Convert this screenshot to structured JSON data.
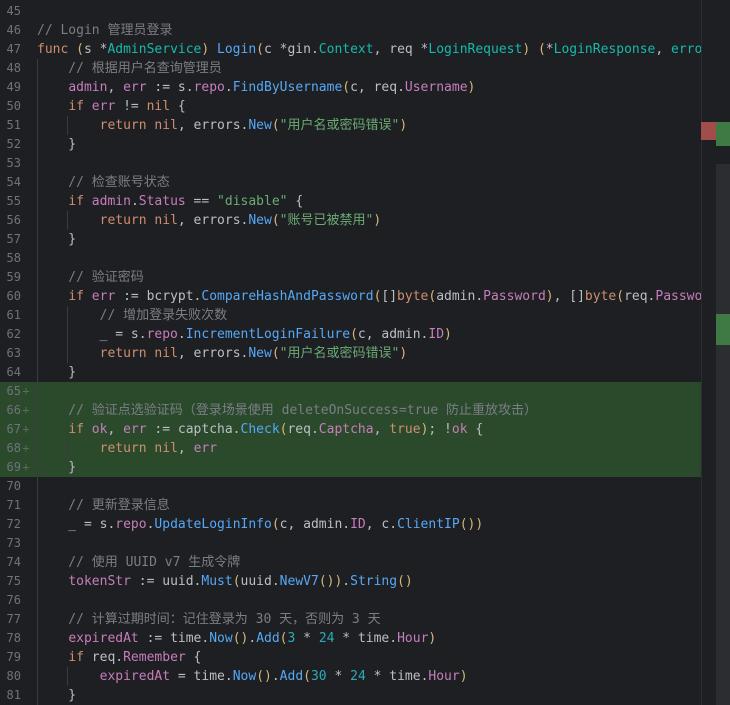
{
  "editor": {
    "lines": [
      {
        "n": "45",
        "added": false,
        "tokens": []
      },
      {
        "n": "46",
        "added": false,
        "tokens": [
          {
            "c": "c",
            "t": "// Login 管理员登录"
          }
        ]
      },
      {
        "n": "47",
        "added": false,
        "tokens": [
          {
            "c": "kw",
            "t": "func "
          },
          {
            "c": "bra",
            "t": "("
          },
          {
            "c": "plain",
            "t": "s "
          },
          {
            "c": "plain",
            "t": "*"
          },
          {
            "c": "ftype",
            "t": "AdminService"
          },
          {
            "c": "bra",
            "t": ")"
          },
          {
            "c": "plain",
            "t": " "
          },
          {
            "c": "fn",
            "t": "Login"
          },
          {
            "c": "bra",
            "t": "("
          },
          {
            "c": "plain",
            "t": "c *"
          },
          {
            "c": "plain",
            "t": "gin"
          },
          {
            "c": "plain",
            "t": "."
          },
          {
            "c": "ftype",
            "t": "Context"
          },
          {
            "c": "plain",
            "t": ", req *"
          },
          {
            "c": "ftype",
            "t": "LoginRequest"
          },
          {
            "c": "bra",
            "t": ")"
          },
          {
            "c": "plain",
            "t": " "
          },
          {
            "c": "bra",
            "t": "("
          },
          {
            "c": "plain",
            "t": "*"
          },
          {
            "c": "ftype",
            "t": "LoginResponse"
          },
          {
            "c": "plain",
            "t": ", "
          },
          {
            "c": "ftype",
            "t": "error"
          },
          {
            "c": "bra",
            "t": ")"
          }
        ]
      },
      {
        "n": "48",
        "added": false,
        "tokens": [
          {
            "c": "c",
            "t": "    // 根据用户名查询管理员"
          }
        ]
      },
      {
        "n": "49",
        "added": false,
        "tokens": [
          {
            "c": "plain",
            "t": "    "
          },
          {
            "c": "fld",
            "t": "admin"
          },
          {
            "c": "plain",
            "t": ", "
          },
          {
            "c": "fld",
            "t": "err"
          },
          {
            "c": "plain",
            "t": " := s."
          },
          {
            "c": "fld",
            "t": "repo"
          },
          {
            "c": "plain",
            "t": "."
          },
          {
            "c": "fn",
            "t": "FindByUsername"
          },
          {
            "c": "bra",
            "t": "("
          },
          {
            "c": "plain",
            "t": "c, req."
          },
          {
            "c": "fld",
            "t": "Username"
          },
          {
            "c": "bra",
            "t": ")"
          }
        ]
      },
      {
        "n": "50",
        "added": false,
        "tokens": [
          {
            "c": "plain",
            "t": "    "
          },
          {
            "c": "kw",
            "t": "if "
          },
          {
            "c": "fld",
            "t": "err"
          },
          {
            "c": "plain",
            "t": " != "
          },
          {
            "c": "kw",
            "t": "nil"
          },
          {
            "c": "plain",
            "t": " {"
          }
        ]
      },
      {
        "n": "51",
        "added": false,
        "tokens": [
          {
            "c": "plain",
            "t": "        "
          },
          {
            "c": "kw",
            "t": "return "
          },
          {
            "c": "kw",
            "t": "nil"
          },
          {
            "c": "plain",
            "t": ", errors."
          },
          {
            "c": "fn",
            "t": "New"
          },
          {
            "c": "bra",
            "t": "("
          },
          {
            "c": "str",
            "t": "\"用户名或密码错误\""
          },
          {
            "c": "bra",
            "t": ")"
          }
        ]
      },
      {
        "n": "52",
        "added": false,
        "tokens": [
          {
            "c": "plain",
            "t": "    }"
          }
        ]
      },
      {
        "n": "53",
        "added": false,
        "tokens": []
      },
      {
        "n": "54",
        "added": false,
        "tokens": [
          {
            "c": "c",
            "t": "    // 检查账号状态"
          }
        ]
      },
      {
        "n": "55",
        "added": false,
        "tokens": [
          {
            "c": "plain",
            "t": "    "
          },
          {
            "c": "kw",
            "t": "if "
          },
          {
            "c": "fld",
            "t": "admin"
          },
          {
            "c": "plain",
            "t": "."
          },
          {
            "c": "fld",
            "t": "Status"
          },
          {
            "c": "plain",
            "t": " == "
          },
          {
            "c": "str",
            "t": "\"disable\""
          },
          {
            "c": "plain",
            "t": " {"
          }
        ]
      },
      {
        "n": "56",
        "added": false,
        "tokens": [
          {
            "c": "plain",
            "t": "        "
          },
          {
            "c": "kw",
            "t": "return "
          },
          {
            "c": "kw",
            "t": "nil"
          },
          {
            "c": "plain",
            "t": ", errors."
          },
          {
            "c": "fn",
            "t": "New"
          },
          {
            "c": "bra",
            "t": "("
          },
          {
            "c": "str",
            "t": "\"账号已被禁用\""
          },
          {
            "c": "bra",
            "t": ")"
          }
        ]
      },
      {
        "n": "57",
        "added": false,
        "tokens": [
          {
            "c": "plain",
            "t": "    }"
          }
        ]
      },
      {
        "n": "58",
        "added": false,
        "tokens": []
      },
      {
        "n": "59",
        "added": false,
        "tokens": [
          {
            "c": "c",
            "t": "    // 验证密码"
          }
        ]
      },
      {
        "n": "60",
        "added": false,
        "tokens": [
          {
            "c": "plain",
            "t": "    "
          },
          {
            "c": "kw",
            "t": "if "
          },
          {
            "c": "fld",
            "t": "err"
          },
          {
            "c": "plain",
            "t": " := bcrypt."
          },
          {
            "c": "fn",
            "t": "CompareHashAndPassword"
          },
          {
            "c": "bra",
            "t": "("
          },
          {
            "c": "plain",
            "t": "[]"
          },
          {
            "c": "kw",
            "t": "byte"
          },
          {
            "c": "bra",
            "t": "("
          },
          {
            "c": "plain",
            "t": "admin."
          },
          {
            "c": "fld",
            "t": "Password"
          },
          {
            "c": "bra",
            "t": ")"
          },
          {
            "c": "plain",
            "t": ", []"
          },
          {
            "c": "kw",
            "t": "byte"
          },
          {
            "c": "bra",
            "t": "("
          },
          {
            "c": "plain",
            "t": "req."
          },
          {
            "c": "fld",
            "t": "Password"
          }
        ]
      },
      {
        "n": "61",
        "added": false,
        "tokens": [
          {
            "c": "c",
            "t": "        // 增加登录失败次数"
          }
        ]
      },
      {
        "n": "62",
        "added": false,
        "tokens": [
          {
            "c": "plain",
            "t": "        _ = s."
          },
          {
            "c": "fld",
            "t": "repo"
          },
          {
            "c": "plain",
            "t": "."
          },
          {
            "c": "fn",
            "t": "IncrementLoginFailure"
          },
          {
            "c": "bra",
            "t": "("
          },
          {
            "c": "plain",
            "t": "c, admin."
          },
          {
            "c": "fld",
            "t": "ID"
          },
          {
            "c": "bra",
            "t": ")"
          }
        ]
      },
      {
        "n": "63",
        "added": false,
        "tokens": [
          {
            "c": "plain",
            "t": "        "
          },
          {
            "c": "kw",
            "t": "return "
          },
          {
            "c": "kw",
            "t": "nil"
          },
          {
            "c": "plain",
            "t": ", errors."
          },
          {
            "c": "fn",
            "t": "New"
          },
          {
            "c": "bra",
            "t": "("
          },
          {
            "c": "str",
            "t": "\"用户名或密码错误\""
          },
          {
            "c": "bra",
            "t": ")"
          }
        ]
      },
      {
        "n": "64",
        "added": false,
        "tokens": [
          {
            "c": "plain",
            "t": "    }"
          }
        ]
      },
      {
        "n": "65",
        "added": true,
        "tokens": []
      },
      {
        "n": "66",
        "added": true,
        "tokens": [
          {
            "c": "c",
            "t": "    // 验证点选验证码（登录场景使用 deleteOnSuccess=true 防止重放攻击）"
          }
        ]
      },
      {
        "n": "67",
        "added": true,
        "tokens": [
          {
            "c": "plain",
            "t": "    "
          },
          {
            "c": "kw",
            "t": "if "
          },
          {
            "c": "fld",
            "t": "ok"
          },
          {
            "c": "plain",
            "t": ", "
          },
          {
            "c": "fld",
            "t": "err"
          },
          {
            "c": "plain",
            "t": " := captcha."
          },
          {
            "c": "fn",
            "t": "Check"
          },
          {
            "c": "bra",
            "t": "("
          },
          {
            "c": "plain",
            "t": "req."
          },
          {
            "c": "fld",
            "t": "Captcha"
          },
          {
            "c": "plain",
            "t": ", "
          },
          {
            "c": "kw",
            "t": "true"
          },
          {
            "c": "bra",
            "t": ")"
          },
          {
            "c": "plain",
            "t": "; !"
          },
          {
            "c": "fld",
            "t": "ok"
          },
          {
            "c": "plain",
            "t": " {"
          }
        ]
      },
      {
        "n": "68",
        "added": true,
        "tokens": [
          {
            "c": "plain",
            "t": "        "
          },
          {
            "c": "kw",
            "t": "return "
          },
          {
            "c": "kw",
            "t": "nil"
          },
          {
            "c": "plain",
            "t": ", "
          },
          {
            "c": "fld",
            "t": "err"
          }
        ]
      },
      {
        "n": "69",
        "added": true,
        "tokens": [
          {
            "c": "plain",
            "t": "    }"
          }
        ]
      },
      {
        "n": "70",
        "added": false,
        "tokens": []
      },
      {
        "n": "71",
        "added": false,
        "tokens": [
          {
            "c": "c",
            "t": "    // 更新登录信息"
          }
        ]
      },
      {
        "n": "72",
        "added": false,
        "tokens": [
          {
            "c": "plain",
            "t": "    _ = s."
          },
          {
            "c": "fld",
            "t": "repo"
          },
          {
            "c": "plain",
            "t": "."
          },
          {
            "c": "fn",
            "t": "UpdateLoginInfo"
          },
          {
            "c": "bra",
            "t": "("
          },
          {
            "c": "plain",
            "t": "c, admin."
          },
          {
            "c": "fld",
            "t": "ID"
          },
          {
            "c": "plain",
            "t": ", c."
          },
          {
            "c": "fn",
            "t": "ClientIP"
          },
          {
            "c": "bra",
            "t": "()"
          },
          {
            "c": "bra",
            "t": ")"
          }
        ]
      },
      {
        "n": "73",
        "added": false,
        "tokens": []
      },
      {
        "n": "74",
        "added": false,
        "tokens": [
          {
            "c": "c",
            "t": "    // 使用 UUID v7 生成令牌"
          }
        ]
      },
      {
        "n": "75",
        "added": false,
        "tokens": [
          {
            "c": "plain",
            "t": "    "
          },
          {
            "c": "fld",
            "t": "tokenStr"
          },
          {
            "c": "plain",
            "t": " := uuid."
          },
          {
            "c": "fn",
            "t": "Must"
          },
          {
            "c": "bra",
            "t": "("
          },
          {
            "c": "plain",
            "t": "uuid."
          },
          {
            "c": "fn",
            "t": "NewV7"
          },
          {
            "c": "bra",
            "t": "()"
          },
          {
            "c": "bra",
            "t": ")"
          },
          {
            "c": "plain",
            "t": "."
          },
          {
            "c": "fn",
            "t": "String"
          },
          {
            "c": "bra",
            "t": "()"
          }
        ]
      },
      {
        "n": "76",
        "added": false,
        "tokens": []
      },
      {
        "n": "77",
        "added": false,
        "tokens": [
          {
            "c": "c",
            "t": "    // 计算过期时间：记住登录为 30 天，否则为 3 天"
          }
        ]
      },
      {
        "n": "78",
        "added": false,
        "tokens": [
          {
            "c": "plain",
            "t": "    "
          },
          {
            "c": "fld",
            "t": "expiredAt"
          },
          {
            "c": "plain",
            "t": " := time."
          },
          {
            "c": "fn",
            "t": "Now"
          },
          {
            "c": "bra",
            "t": "()"
          },
          {
            "c": "plain",
            "t": "."
          },
          {
            "c": "fn",
            "t": "Add"
          },
          {
            "c": "bra",
            "t": "("
          },
          {
            "c": "nm",
            "t": "3"
          },
          {
            "c": "plain",
            "t": " * "
          },
          {
            "c": "nm",
            "t": "24"
          },
          {
            "c": "plain",
            "t": " * time."
          },
          {
            "c": "fld",
            "t": "Hour"
          },
          {
            "c": "bra",
            "t": ")"
          }
        ]
      },
      {
        "n": "79",
        "added": false,
        "tokens": [
          {
            "c": "plain",
            "t": "    "
          },
          {
            "c": "kw",
            "t": "if "
          },
          {
            "c": "plain",
            "t": "req."
          },
          {
            "c": "fld",
            "t": "Remember"
          },
          {
            "c": "plain",
            "t": " {"
          }
        ]
      },
      {
        "n": "80",
        "added": false,
        "tokens": [
          {
            "c": "plain",
            "t": "        "
          },
          {
            "c": "fld",
            "t": "expiredAt"
          },
          {
            "c": "plain",
            "t": " = time."
          },
          {
            "c": "fn",
            "t": "Now"
          },
          {
            "c": "bra",
            "t": "()"
          },
          {
            "c": "plain",
            "t": "."
          },
          {
            "c": "fn",
            "t": "Add"
          },
          {
            "c": "bra",
            "t": "("
          },
          {
            "c": "nm",
            "t": "30"
          },
          {
            "c": "plain",
            "t": " * "
          },
          {
            "c": "nm",
            "t": "24"
          },
          {
            "c": "plain",
            "t": " * time."
          },
          {
            "c": "fld",
            "t": "Hour"
          },
          {
            "c": "bra",
            "t": ")"
          }
        ]
      },
      {
        "n": "81",
        "added": false,
        "tokens": [
          {
            "c": "plain",
            "t": "    }"
          }
        ]
      }
    ],
    "added_marker": "+"
  },
  "colors": {
    "background": "#1e1f22",
    "added_line": "#2b4a2c",
    "marker_red": "#a14d4a",
    "marker_green": "#3f7a45"
  }
}
